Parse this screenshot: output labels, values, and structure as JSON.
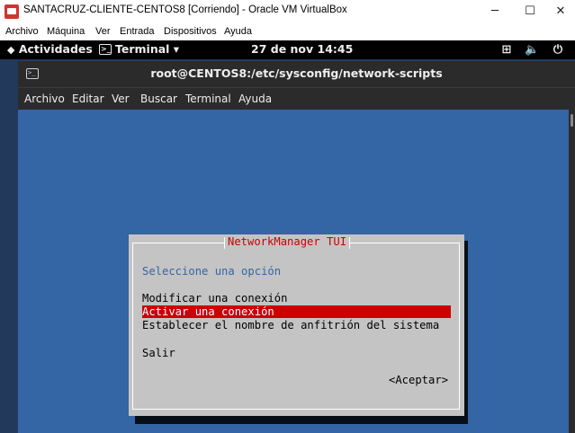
{
  "vbox": {
    "title": "SANTACRUZ-CLIENTE-CENTOS8 [Corriendo] - Oracle VM VirtualBox",
    "window_buttons": {
      "minimize": "─",
      "maximize": "☐",
      "close": "✕"
    },
    "menu": [
      "Archivo",
      "Máquina",
      "Ver",
      "Entrada",
      "Dispositivos",
      "Ayuda"
    ]
  },
  "gnome": {
    "activities": "Actividades",
    "app_menu": "Terminal",
    "app_menu_arrow": "▾",
    "clock": "27 de nov  14:45",
    "tray": {
      "network": "⊞",
      "volume": "🔈",
      "power": "⏻"
    }
  },
  "terminal": {
    "title": "root@CENTOS8:/etc/sysconfig/network-scripts",
    "menu": [
      "Archivo",
      "Editar",
      "Ver",
      "Buscar",
      "Terminal",
      "Ayuda"
    ]
  },
  "nmtui": {
    "title": "NetworkManager TUI",
    "prompt": "Seleccione una opción",
    "options": [
      {
        "label": "Modificar una conexión",
        "selected": false
      },
      {
        "label": "Activar una conexión",
        "selected": true
      },
      {
        "label": "Establecer el nombre de anfitrión del sistema",
        "selected": false
      }
    ],
    "quit": "Salir",
    "accept": "<Aceptar>"
  },
  "colors": {
    "terminal_bg": "#3465a4",
    "dialog_bg": "#c4c4c4",
    "highlight": "#cc0000",
    "prompt_text": "#3465a4"
  }
}
